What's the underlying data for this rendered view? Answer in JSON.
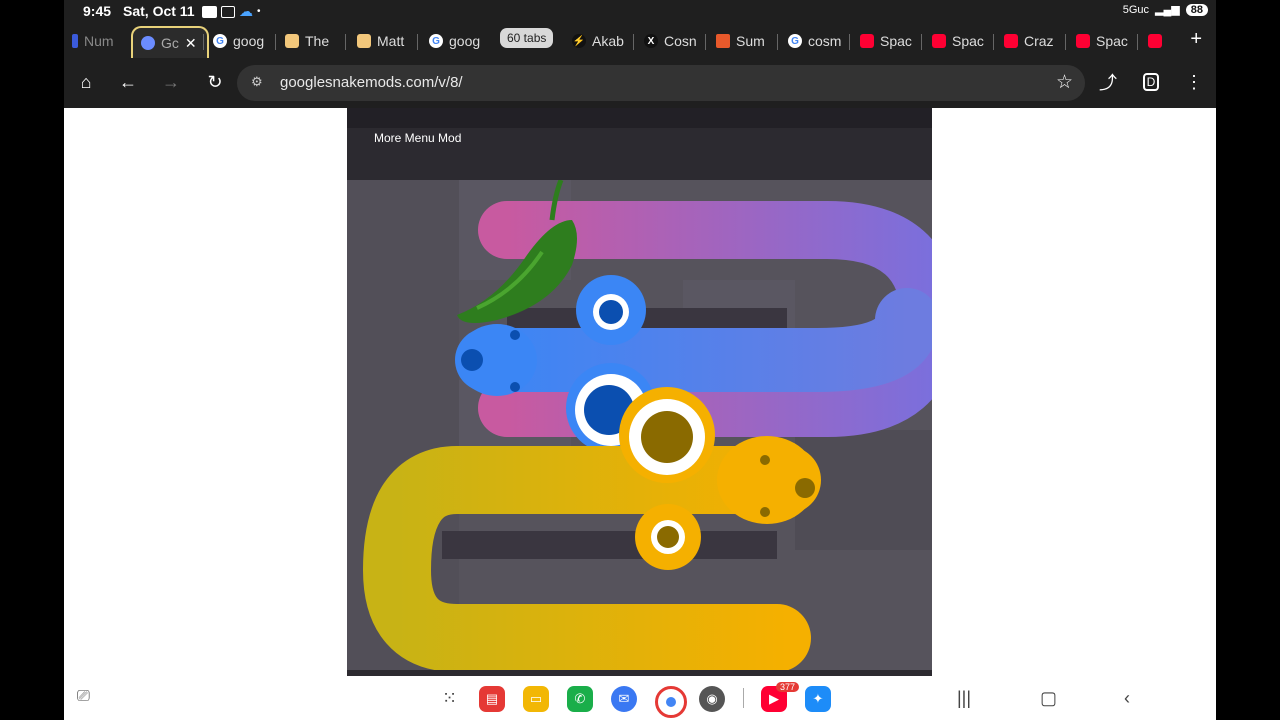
{
  "status": {
    "time": "9:45",
    "date": "Sat, Oct 11",
    "network": "5Guc",
    "battery": "88"
  },
  "tabs": [
    {
      "label": "Num",
      "fav_color": "#3b5bdb"
    },
    {
      "label": "Gc",
      "fav_color": "#6b8cff",
      "active": true
    },
    {
      "label": "goog",
      "fav_color": "#ffffff"
    },
    {
      "label": "The",
      "fav_color": "#f2c77b"
    },
    {
      "label": "Matt",
      "fav_color": "#f2c77b"
    },
    {
      "label": "goog",
      "fav_color": "#ffffff"
    },
    {
      "label": "Akab",
      "fav_color": "#111111"
    },
    {
      "label": "Cosn",
      "fav_color": "#111111"
    },
    {
      "label": "Sum",
      "fav_color": "#e8592b"
    },
    {
      "label": "cosm",
      "fav_color": "#ffffff"
    },
    {
      "label": "Spac",
      "fav_color": "#ff0033"
    },
    {
      "label": "Spac",
      "fav_color": "#ff0033"
    },
    {
      "label": "Craz",
      "fav_color": "#ff0033"
    },
    {
      "label": "Spac",
      "fav_color": "#ff0033"
    }
  ],
  "tab_count": "60 tabs",
  "toolbar": {
    "url": "googlesnakemods.com/v/8/"
  },
  "game": {
    "menu_label": "More Menu Mod"
  },
  "dock": {
    "youtube_badge": "377"
  },
  "icons": {
    "home": "home-icon",
    "back": "back-arrow-icon",
    "forward": "forward-arrow-icon",
    "reload": "reload-icon",
    "star": "star-icon",
    "share": "share-icon",
    "menu": "more-vert-icon"
  }
}
